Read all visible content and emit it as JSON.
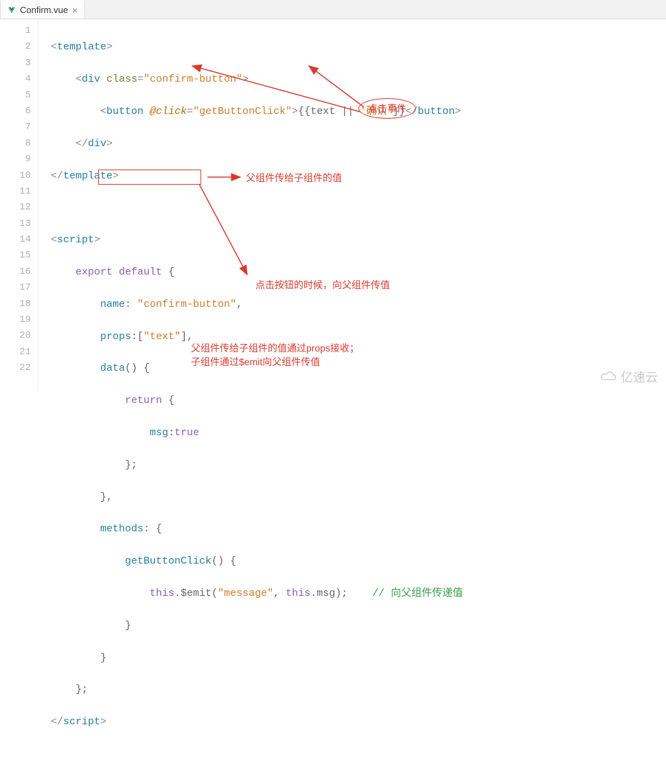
{
  "tab": {
    "filename": "Confirm.vue",
    "close_glyph": "×"
  },
  "gutter": {
    "start": 1,
    "end": 22
  },
  "code": {
    "tag_template_open": "template",
    "tag_div": "div",
    "attr_class": "class",
    "val_class": "confirm-button",
    "tag_button": "button",
    "attr_click": "@click",
    "val_click": "getButtonClick",
    "expr_text": "text",
    "expr_or": "||",
    "expr_default": "确认",
    "tag_script": "script",
    "kw_export": "export",
    "kw_default": "default",
    "prop_name": "name",
    "val_name": "confirm-button",
    "prop_props": "props",
    "val_props_item": "text",
    "fn_data": "data",
    "kw_return": "return",
    "prop_msg": "msg",
    "val_msg": "true",
    "prop_methods": "methods",
    "fn_getButtonClick": "getButtonClick",
    "kw_this1": "this",
    "fn_emit": "$emit",
    "val_message": "message",
    "kw_this2": "this",
    "ref_msg": "msg",
    "cmt_emit": "// 向父组件传递值"
  },
  "annotations": {
    "click_event": "点击事件",
    "props_note": "父组件传给子组件的值",
    "emit_note": "点击按钮的时候，向父组件传值",
    "summary_l1": "父组件传给子组件的值通过props接收；",
    "summary_l2": "子组件通过$emit向父组件传值"
  },
  "watermark": "亿速云"
}
